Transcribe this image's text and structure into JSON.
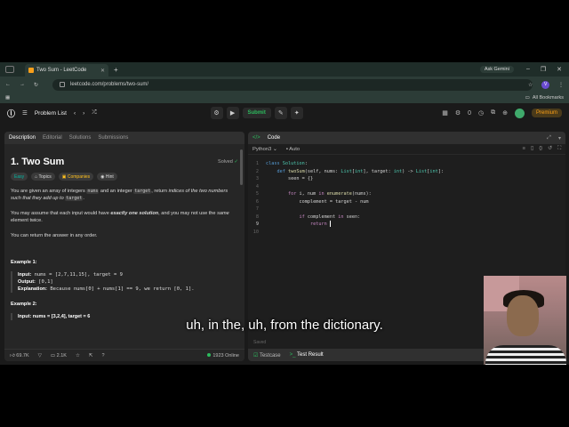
{
  "browser": {
    "tab_title": "Two Sum - LeetCode",
    "url": "leetcode.com/problems/two-sum/",
    "ask_gemini": "Ask Gemini",
    "all_bookmarks": "All Bookmarks",
    "avatar_letter": "V"
  },
  "lc_header": {
    "problem_list": "Problem List",
    "submit": "Submit",
    "streak": "0",
    "premium": "Premium"
  },
  "left_tabs": [
    "Description",
    "Editorial",
    "Solutions",
    "Submissions"
  ],
  "problem": {
    "title": "1. Two Sum",
    "solved": "Solved",
    "tags": [
      "Easy",
      "Topics",
      "Companies",
      "Hint"
    ],
    "p1_a": "You are given an array of integers ",
    "p1_code1": "nums",
    "p1_b": " and an integer ",
    "p1_code2": "target",
    "p1_c": ", return ",
    "p1_d": "indices of the two numbers such that they add up to ",
    "p1_code3": "target",
    "p1_e": ".",
    "p2_a": "You may assume that each input would have ",
    "p2_b": "exactly one solution",
    "p2_c": ", and you may not use the ",
    "p2_d": "same",
    "p2_e": " element twice.",
    "p3": "You can return the answer in any order.",
    "ex1_title": "Example 1:",
    "ex1_input_label": "Input:",
    "ex1_input": " nums = [2,7,11,15], target = 9",
    "ex1_output_label": "Output:",
    "ex1_output": " [0,1]",
    "ex1_expl_label": "Explanation:",
    "ex1_expl": " Because nums[0] + nums[1] == 9, we return [0, 1].",
    "ex2_title": "Example 2:",
    "ex2_input": "Input: nums = [3,2,4], target = 6"
  },
  "left_footer": {
    "likes": "69.7K",
    "comments": "2.1K",
    "online": "1923 Online"
  },
  "code_pane": {
    "title": "Code",
    "language": "Python3",
    "auto": "Auto",
    "saved": "Saved",
    "testcase": "Testcase",
    "test_result": "Test Result",
    "line_numbers": [
      "1",
      "2",
      "3",
      "4",
      "5",
      "6",
      "7",
      "8",
      "9",
      "10"
    ],
    "current_line": "9"
  },
  "subtitle": "uh, in the, uh, from the dictionary."
}
